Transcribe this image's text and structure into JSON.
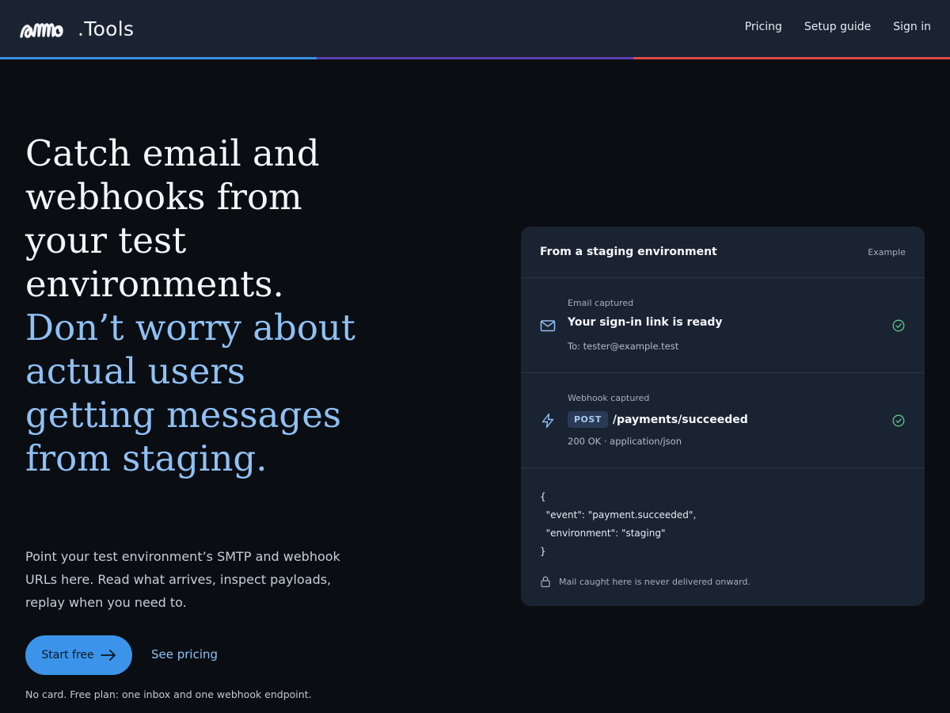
{
  "header": {
    "brand_mark": "ammo",
    "brand_suffix": ".Tools",
    "nav": [
      {
        "label": "Pricing"
      },
      {
        "label": "Setup guide"
      },
      {
        "label": "Sign in"
      }
    ],
    "accent_colors": [
      "#3b8fe0",
      "#5b3fb0",
      "#e04848"
    ]
  },
  "hero": {
    "headline_part1": "Catch email and webhooks from your test environments.",
    "headline_part2": "Don’t worry about actual users getting messages from staging.",
    "lede": "Point your test environment’s SMTP and webhook URLs here. Read what arrives, inspect payloads, replay when you need to.",
    "cta_primary": "Start free",
    "cta_secondary": "See pricing",
    "fineprint": "No card. Free plan: one inbox and one webhook endpoint."
  },
  "card": {
    "title": "From a staging environment",
    "tag": "Example",
    "events": [
      {
        "icon": "mail-icon",
        "kind": "Email captured",
        "title": "Your sign-in link is ready",
        "sub": "To: tester@example.test",
        "status": "check-circle-icon"
      },
      {
        "icon": "bolt-icon",
        "kind": "Webhook captured",
        "method": "POST",
        "title": "/payments/succeeded",
        "sub": "200 OK · application/json",
        "status": "check-circle-icon"
      }
    ],
    "payload": "{\n  \"event\": \"payment.succeeded\",\n  \"environment\": \"staging\"\n}",
    "note": "Mail caught here is never delivered onward."
  },
  "colors": {
    "primary": "#3b94ea",
    "accent_text": "#8fc1f5",
    "success": "#5cc98a",
    "card_bg": "#1a2332",
    "page_bg": "#0a0d12"
  }
}
